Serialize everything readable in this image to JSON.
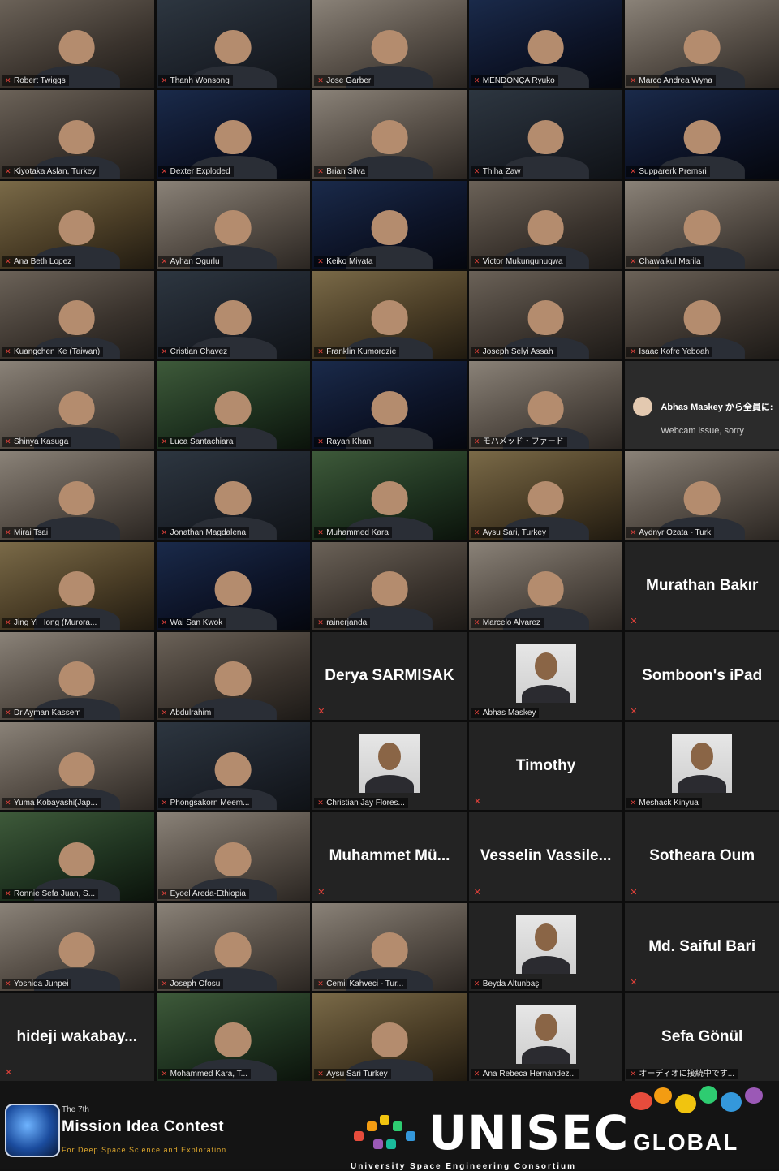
{
  "participants": [
    {
      "name": "Robert Twiggs",
      "kind": "video",
      "v": "v1"
    },
    {
      "name": "Thanh Wonsong",
      "kind": "video",
      "v": "v2"
    },
    {
      "name": "Jose Garber",
      "kind": "video",
      "v": "v3"
    },
    {
      "name": "MENDONÇA Ryuko",
      "kind": "video",
      "v": "v4"
    },
    {
      "name": "Marco Andrea Wyna",
      "kind": "video",
      "v": "v3"
    },
    {
      "name": "Kiyotaka Aslan, Turkey",
      "kind": "video",
      "v": "v1"
    },
    {
      "name": "Dexter Exploded",
      "kind": "video",
      "v": "v4"
    },
    {
      "name": "Brian Silva",
      "kind": "video",
      "v": "v3"
    },
    {
      "name": "Thiha Zaw",
      "kind": "video",
      "v": "v2"
    },
    {
      "name": "Supparerk Premsri",
      "kind": "video",
      "v": "v4"
    },
    {
      "name": "Ana Beth Lopez",
      "kind": "video",
      "v": "v6"
    },
    {
      "name": "Ayhan Ogurlu",
      "kind": "video",
      "v": "v3"
    },
    {
      "name": "Keiko Miyata",
      "kind": "video",
      "v": "v4"
    },
    {
      "name": "Victor Mukungunugwa",
      "kind": "video",
      "v": "v1"
    },
    {
      "name": "Chawalkul Marila",
      "kind": "video",
      "v": "v3"
    },
    {
      "name": "Kuangchen Ke (Taiwan)",
      "kind": "video",
      "v": "v1"
    },
    {
      "name": "Cristian Chavez",
      "kind": "video",
      "v": "v2"
    },
    {
      "name": "Franklin Kumordzie",
      "kind": "video",
      "v": "v6"
    },
    {
      "name": "Joseph Selyi Assah",
      "kind": "video",
      "v": "v1"
    },
    {
      "name": "Isaac Kofre Yeboah",
      "kind": "video",
      "v": "v1"
    },
    {
      "name": "Shinya Kasuga",
      "kind": "video",
      "v": "v3"
    },
    {
      "name": "Luca Santachiara",
      "kind": "video",
      "v": "v5"
    },
    {
      "name": "Rayan Khan",
      "kind": "video",
      "v": "v4"
    },
    {
      "name": "モハメッド・ファード",
      "kind": "video",
      "v": "v3"
    },
    {
      "name": "__chat__",
      "kind": "chat"
    },
    {
      "name": "Mirai Tsai",
      "kind": "video",
      "v": "v3"
    },
    {
      "name": "Jonathan Magdalena",
      "kind": "video",
      "v": "v2"
    },
    {
      "name": "Muhammed Kara",
      "kind": "video",
      "v": "v5"
    },
    {
      "name": "Aysu Sari, Turkey",
      "kind": "video",
      "v": "v6"
    },
    {
      "name": "Aydnyr Ozata - Turk",
      "kind": "video",
      "v": "v3"
    },
    {
      "name": "Jing Yi Hong (Murora...",
      "kind": "video",
      "v": "v6"
    },
    {
      "name": "Wai San Kwok",
      "kind": "video",
      "v": "v4"
    },
    {
      "name": "rainerjanda",
      "kind": "video",
      "v": "v1"
    },
    {
      "name": "Marcelo Alvarez",
      "kind": "video",
      "v": "v3"
    },
    {
      "name": "Murathan Bakır",
      "kind": "name"
    },
    {
      "name": "Dr Ayman Kassem",
      "kind": "video",
      "v": "v3"
    },
    {
      "name": "Abdulrahim",
      "kind": "video",
      "v": "v1"
    },
    {
      "name": "Derya SARMISAK",
      "kind": "name"
    },
    {
      "name": "Abhas Maskey",
      "kind": "photo"
    },
    {
      "name": "Somboon's iPad",
      "kind": "name"
    },
    {
      "name": "Yuma Kobayashi(Jap...",
      "kind": "video",
      "v": "v3"
    },
    {
      "name": "Phongsakorn Meem...",
      "kind": "video",
      "v": "v2"
    },
    {
      "name": "Christian Jay Flores...",
      "kind": "photo"
    },
    {
      "name": "Timothy",
      "kind": "name"
    },
    {
      "name": "Meshack Kinyua",
      "kind": "photo"
    },
    {
      "name": "Ronnie Sefa Juan, S...",
      "kind": "video",
      "v": "v5"
    },
    {
      "name": "Eyoel Areda-Ethiopia",
      "kind": "video",
      "v": "v3"
    },
    {
      "name": "Muhammet Mü...",
      "kind": "name"
    },
    {
      "name": "Vesselin Vassile...",
      "kind": "name"
    },
    {
      "name": "Sotheara Oum",
      "kind": "name"
    },
    {
      "name": "Yoshida Junpei",
      "kind": "video",
      "v": "v3"
    },
    {
      "name": "Joseph Ofosu",
      "kind": "video",
      "v": "v3"
    },
    {
      "name": "Cemil Kahveci - Tur...",
      "kind": "video",
      "v": "v3"
    },
    {
      "name": "Beyda Altunbaş",
      "kind": "photo"
    },
    {
      "name": "Md. Saiful Bari",
      "kind": "name"
    },
    {
      "name": "hideji wakabay...",
      "kind": "name"
    },
    {
      "name": "Mohammed Kara, T...",
      "kind": "video",
      "v": "v5"
    },
    {
      "name": "Aysu Sari Turkey",
      "kind": "video",
      "v": "v6"
    },
    {
      "name": "Ana Rebeca Hernández...",
      "kind": "photo"
    },
    {
      "name": "Sefa Gönül",
      "kind": "name_sub",
      "sub": "オーディオに接続中です..."
    }
  ],
  "chat": {
    "from": "Abhas Maskey から全員に:",
    "message": "Webcam issue, sorry"
  },
  "footer": {
    "mic_ordinal": "The 7th",
    "mic_title": "Mission Idea Contest",
    "mic_subtitle": "For Deep Space Science and Exploration",
    "unisec_word": "UNISEC",
    "unisec_global": "GLOBAL",
    "unisec_subtitle": "University Space Engineering Consortium"
  },
  "colors": {
    "muted_red": "#e0413a",
    "tile_bg": "#232323",
    "mic_gold": "#e0a92e"
  },
  "icons": {
    "muted": "microphone-muted-icon"
  }
}
